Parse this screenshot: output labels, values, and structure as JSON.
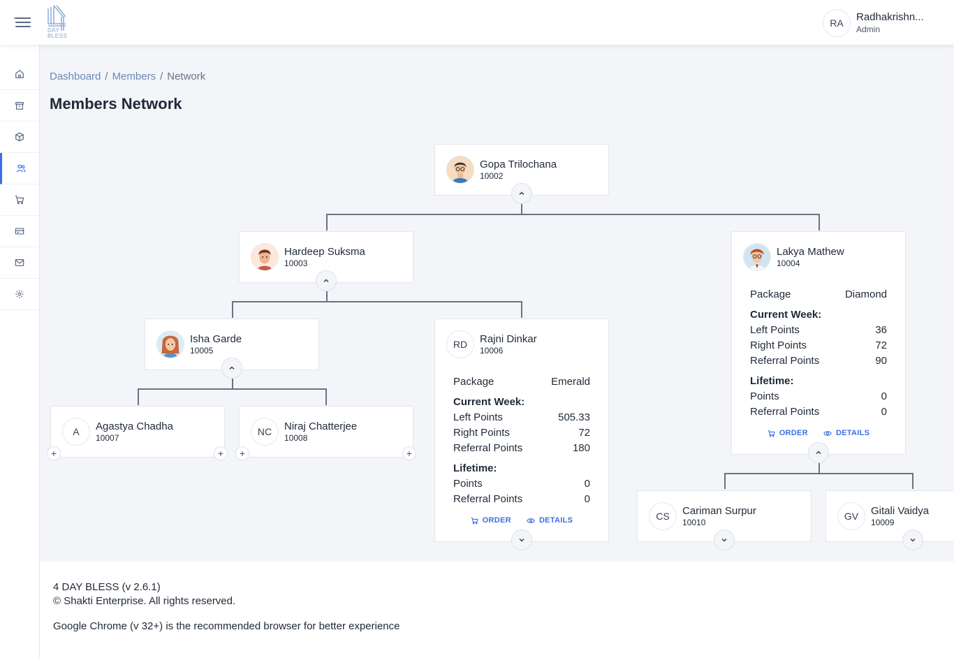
{
  "header": {
    "logo_text": "DAY BLESS",
    "user": {
      "initials": "RA",
      "name": "Radhakrishn...",
      "role": "Admin"
    }
  },
  "sidebar": {
    "items": [
      {
        "icon": "home-icon"
      },
      {
        "icon": "archive-icon"
      },
      {
        "icon": "box-icon"
      },
      {
        "icon": "users-icon",
        "active": true
      },
      {
        "icon": "cart-icon"
      },
      {
        "icon": "credit-card-icon"
      },
      {
        "icon": "mail-icon"
      },
      {
        "icon": "settings-icon"
      }
    ]
  },
  "breadcrumb": {
    "items": [
      "Dashboard",
      "Members",
      "Network"
    ]
  },
  "page": {
    "title": "Members Network"
  },
  "labels": {
    "package": "Package",
    "current_week": "Current Week:",
    "left_points": "Left Points",
    "right_points": "Right Points",
    "referral_points": "Referral Points",
    "lifetime": "Lifetime:",
    "points": "Points",
    "order": "ORDER",
    "details": "DETAILS"
  },
  "members": {
    "gopa": {
      "name": "Gopa Trilochana",
      "id": "10002"
    },
    "hardeep": {
      "name": "Hardeep Suksma",
      "id": "10003"
    },
    "lakya": {
      "name": "Lakya Mathew",
      "id": "10004",
      "package": "Diamond",
      "left_points": "36",
      "right_points": "72",
      "referral_points": "90",
      "lifetime_points": "0",
      "lifetime_referral_points": "0"
    },
    "isha": {
      "name": "Isha Garde",
      "id": "10005"
    },
    "rajni": {
      "initials": "RD",
      "name": "Rajni Dinkar",
      "id": "10006",
      "package": "Emerald",
      "left_points": "505.33",
      "right_points": "72",
      "referral_points": "180",
      "lifetime_points": "0",
      "lifetime_referral_points": "0"
    },
    "agastya": {
      "initials": "A",
      "name": "Agastya Chadha",
      "id": "10007"
    },
    "niraj": {
      "initials": "NC",
      "name": "Niraj Chatterjee",
      "id": "10008"
    },
    "cariman": {
      "initials": "CS",
      "name": "Cariman Surpur",
      "id": "10010"
    },
    "gitali": {
      "initials": "GV",
      "name": "Gitali Vaidya",
      "id": "10009"
    }
  },
  "footer": {
    "version": "4 DAY BLESS (v 2.6.1)",
    "copyright": "© Shakti Enterprise. All rights reserved.",
    "browser_note": "Google Chrome (v 32+) is the recommended browser for better experience"
  },
  "colors": {
    "accent": "#3b6fe6",
    "background": "#f3f5f9",
    "line": "#6b7280"
  }
}
